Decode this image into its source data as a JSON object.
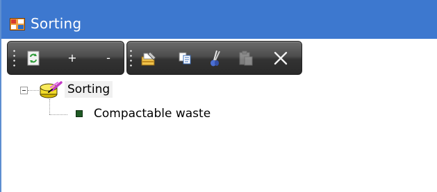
{
  "window": {
    "title": "Sorting",
    "title_bar_color": "#3d78cf",
    "app_icon": "windows-form-icon"
  },
  "toolbar": {
    "group1": [
      {
        "name": "refresh",
        "icon": "refresh-icon"
      },
      {
        "name": "add",
        "label": "+"
      },
      {
        "name": "remove",
        "label": "-"
      }
    ],
    "group2": [
      {
        "name": "properties",
        "icon": "properties-icon",
        "enabled": true
      },
      {
        "name": "copy",
        "icon": "copy-icon",
        "enabled": true
      },
      {
        "name": "cut",
        "icon": "cut-icon",
        "enabled": true
      },
      {
        "name": "paste",
        "icon": "paste-icon",
        "enabled": false
      },
      {
        "name": "delete",
        "icon": "delete-icon",
        "enabled": true
      }
    ]
  },
  "tree": {
    "root": {
      "label": "Sorting",
      "expanded": true,
      "selected": true,
      "icon": "database-folder-icon"
    },
    "children": [
      {
        "label": "Compactable waste",
        "icon": "green-square-icon",
        "color": "#1f5a24"
      }
    ]
  }
}
